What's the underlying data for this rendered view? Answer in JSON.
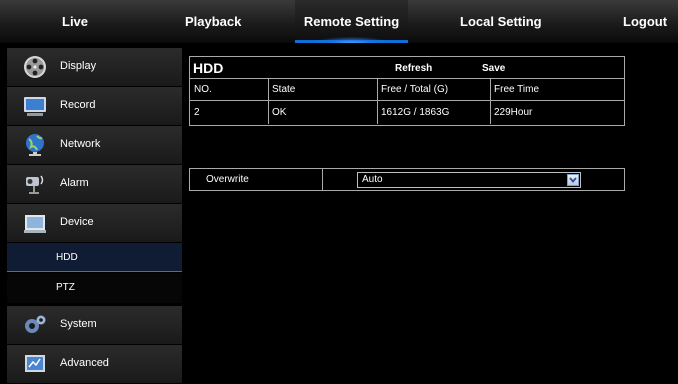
{
  "nav": {
    "tabs": [
      {
        "label": "Live"
      },
      {
        "label": "Playback"
      },
      {
        "label": "Remote Setting"
      },
      {
        "label": "Local Setting"
      },
      {
        "label": "Logout"
      }
    ]
  },
  "sidebar": {
    "items": [
      {
        "label": "Display",
        "icon": "film-reel-icon"
      },
      {
        "label": "Record",
        "icon": "monitor-record-icon"
      },
      {
        "label": "Network",
        "icon": "globe-icon"
      },
      {
        "label": "Alarm",
        "icon": "camera-alarm-icon"
      },
      {
        "label": "Device",
        "icon": "device-icon"
      }
    ],
    "subitems": [
      {
        "label": "HDD",
        "active": true
      },
      {
        "label": "PTZ",
        "active": false
      }
    ],
    "items2": [
      {
        "label": "System",
        "icon": "gears-icon"
      },
      {
        "label": "Advanced",
        "icon": "advanced-icon"
      }
    ]
  },
  "hdd": {
    "title": "HDD",
    "refresh_label": "Refresh",
    "save_label": "Save",
    "columns": [
      "NO.",
      "State",
      "Free / Total (G)",
      "Free Time"
    ],
    "rows": [
      [
        "2",
        "OK",
        "1612G / 1863G",
        "229Hour"
      ]
    ]
  },
  "overwrite": {
    "label": "Overwrite",
    "value": "Auto"
  }
}
